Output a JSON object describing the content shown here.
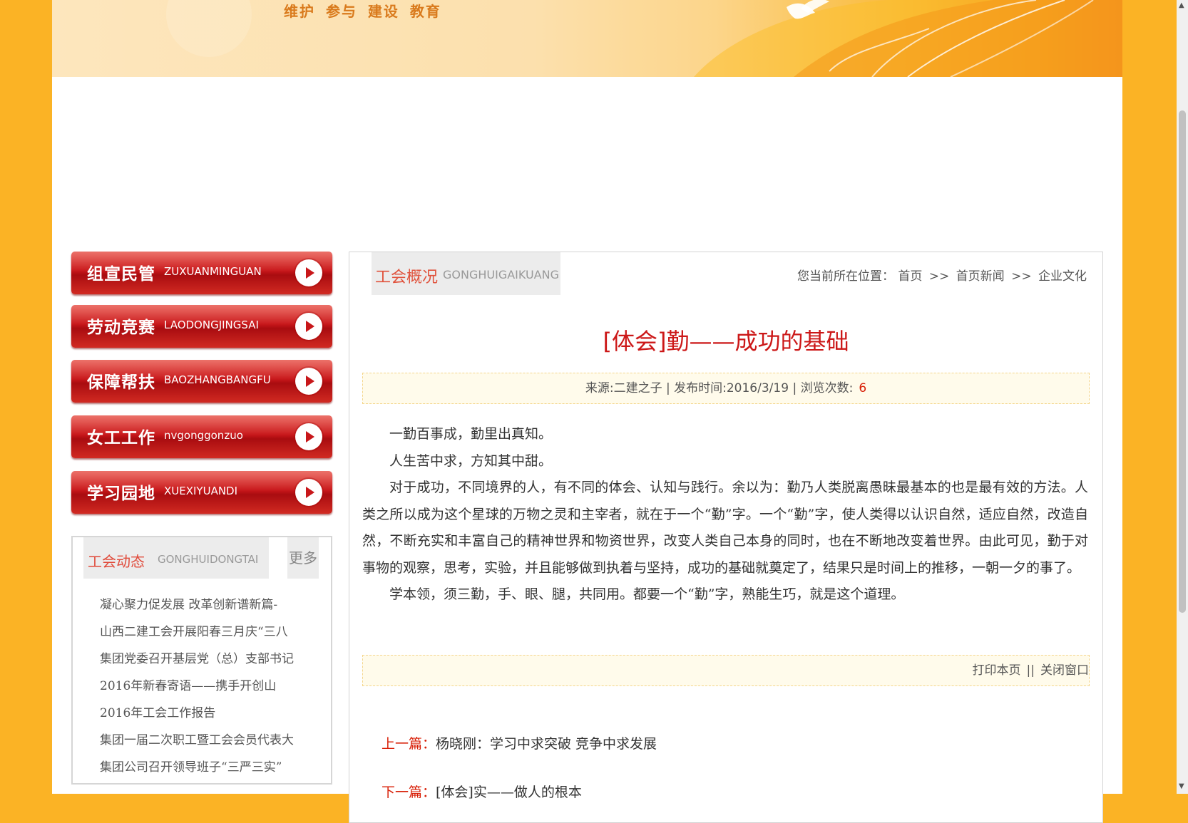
{
  "banner": {
    "slogan": "维护 参与 建设 教育"
  },
  "sidebar": {
    "nav": [
      {
        "cn": "组宣民管",
        "en": "ZUXUANMINGUAN"
      },
      {
        "cn": "劳动竞赛",
        "en": "LAODONGJINGSAI"
      },
      {
        "cn": "保障帮扶",
        "en": "BAOZHANGBANGFU"
      },
      {
        "cn": "女工工作",
        "en": "nvgonggonzuo"
      },
      {
        "cn": "学习园地",
        "en": "XUEXIYUANDI"
      }
    ],
    "news": {
      "title_cn": "工会动态",
      "title_en": "GONGHUIDONGTAI",
      "more": "更多",
      "items": [
        "凝心聚力促发展 改革创新谱新篇-",
        "山西二建工会开展阳春三月庆“三八",
        "集团党委召开基层党（总）支部书记",
        "2016年新春寄语——携手开创山",
        "2016年工会工作报告",
        "集团一届二次职工暨工会会员代表大",
        "集团公司召开领导班子“三严三实”"
      ]
    }
  },
  "content": {
    "section_cn": "工会概况",
    "section_en": "GONGHUIGAIKUANG",
    "breadcrumb": {
      "prefix": "您当前所在位置：",
      "home": "首页",
      "sep": ">>",
      "level1": "首页新闻",
      "level2": "企业文化"
    },
    "title": "[体会]勤——成功的基础",
    "meta": {
      "source_label": "来源:",
      "source": "二建之子",
      "date_label": "发布时间:",
      "date": "2016/3/19",
      "views_label": "浏览次数:",
      "views": "6",
      "sep": "|"
    },
    "paragraphs": [
      "一勤百事成，勤里出真知。",
      "人生苦中求，方知其中甜。",
      "对于成功，不同境界的人，有不同的体会、认知与践行。余以为：勤乃人类脱离愚昧最基本的也是最有效的方法。人类之所以成为这个星球的万物之灵和主宰者，就在于一个“勤”字。一个“勤”字，使人类得以认识自然，适应自然，改造自然，不断充实和丰富自己的精神世界和物资世界，改变人类自己本身的同时，也在不断地改变着世界。由此可见，勤于对事物的观察，思考，实验，并且能够做到执着与坚持，成功的基础就奠定了，结果只是时间上的推移，一朝一夕的事了。",
      "学本领，须三勤，手、眼、腿，共同用。都要一个“勤”字，熟能生巧，就是这个道理。"
    ],
    "tools": {
      "print": "打印本页",
      "sep": "||",
      "close": "关闭窗口"
    },
    "prev": {
      "label": "上一篇：",
      "title": "杨晓刚：学习中求突破 竞争中求发展"
    },
    "next": {
      "label": "下一篇：",
      "title": "[体会]实——做人的根本"
    }
  },
  "colors": {
    "background": "#fbb325",
    "accent_red": "#cc1818",
    "nav_red": "#c8171a"
  }
}
